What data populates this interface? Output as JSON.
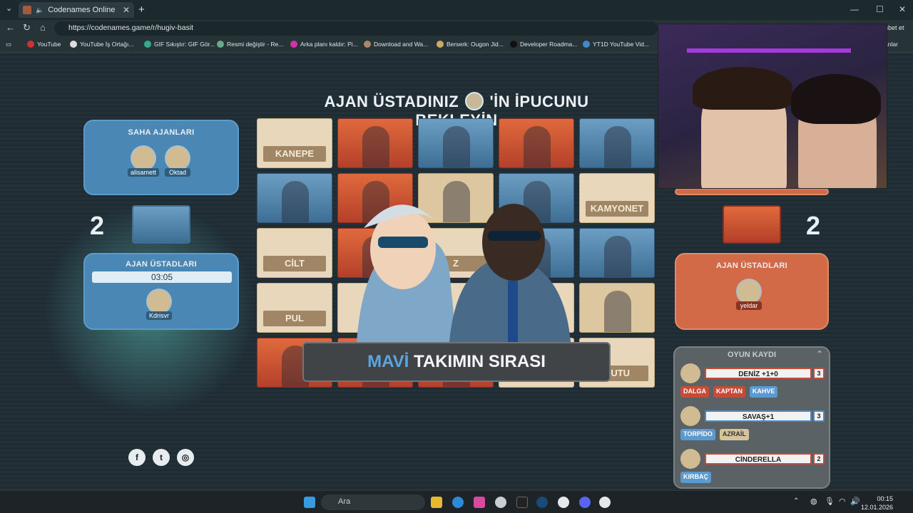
{
  "browser": {
    "tab_title": "Codenames Online",
    "url": "https://codenames.game/r/hugiv-basit",
    "bookmarks": [
      "YouTube",
      "YouTube İş Ortağı...",
      "GIF Sıkıştır: GIF Gör...",
      "Resmi değiştir - Re...",
      "Arka planı kaldır: Pi...",
      "Download and Wa...",
      "Berserk: Ougon Jid...",
      "Developer Roadma...",
      "YT1D YouTube Vid..."
    ],
    "right_edge_fragments": [
      "hbet et",
      "anlar"
    ]
  },
  "headline": {
    "part1": "AJAN ÜSTADINIZ",
    "part2": "'İN İPUCUNU BEKLEYİN",
    "avatar_tag": "Kdrisvr"
  },
  "blue_team": {
    "field_title": "SAHA AJANLARI",
    "field_players": [
      "alisamett",
      "Oktad"
    ],
    "score": "2",
    "spymaster_title": "AJAN ÜSTADLARI",
    "timer": "03:05",
    "spymaster": "Kdrisvr"
  },
  "red_team": {
    "score": "2",
    "spymaster_title": "AJAN ÜSTADLARI",
    "spymaster": "yeldar"
  },
  "board": {
    "cards": [
      {
        "type": "word",
        "text": "KANEPE"
      },
      {
        "type": "red",
        "text": ""
      },
      {
        "type": "blue",
        "text": ""
      },
      {
        "type": "red",
        "text": ""
      },
      {
        "type": "blue",
        "text": ""
      },
      {
        "type": "blue",
        "text": ""
      },
      {
        "type": "red",
        "text": ""
      },
      {
        "type": "neutral",
        "text": ""
      },
      {
        "type": "blue",
        "text": ""
      },
      {
        "type": "word",
        "text": "KAMYONET"
      },
      {
        "type": "word",
        "text": "CİLT"
      },
      {
        "type": "red",
        "text": ""
      },
      {
        "type": "word",
        "text": "Z"
      },
      {
        "type": "blue",
        "text": ""
      },
      {
        "type": "blue",
        "text": ""
      },
      {
        "type": "word",
        "text": "PUL"
      },
      {
        "type": "word",
        "text": ""
      },
      {
        "type": "word",
        "text": ""
      },
      {
        "type": "word",
        "text": ""
      },
      {
        "type": "neutral",
        "text": ""
      },
      {
        "type": "red",
        "text": ""
      },
      {
        "type": "red",
        "text": ""
      },
      {
        "type": "red",
        "text": ""
      },
      {
        "type": "word",
        "text": ""
      },
      {
        "type": "word",
        "text": "KUTU"
      }
    ]
  },
  "turn_banner": {
    "team": "MAVİ",
    "rest": "TAKIMIN SIRASI"
  },
  "game_log": {
    "title": "OYUN KAYDI",
    "entries": [
      {
        "team": "red",
        "player": "yeldar",
        "clue": "DENİZ +1+0",
        "number": "3",
        "guesses": [
          {
            "team": "red",
            "word": "DALGA"
          },
          {
            "team": "red",
            "word": "KAPTAN"
          },
          {
            "team": "blue",
            "word": "KAHVE"
          }
        ]
      },
      {
        "team": "blue",
        "player": "Kdrisvr",
        "clue": "SAVAŞ+1",
        "number": "3",
        "guesses": [
          {
            "team": "blue",
            "word": "TORPİDO"
          },
          {
            "team": "neutral",
            "word": "AZRAİL"
          }
        ]
      },
      {
        "team": "red",
        "player": "yeldar",
        "clue": "CİNDERELLA",
        "number": "2",
        "guesses": [
          {
            "team": "blue",
            "word": "KIRBAÇ"
          }
        ]
      }
    ]
  },
  "taskbar": {
    "search_placeholder": "Ara",
    "time": "00:15",
    "date": "12.01.2026"
  },
  "colors": {
    "blue_team": "#4a87b4",
    "red_team": "#d26a48",
    "mavi_accent": "#5aa6e0"
  }
}
